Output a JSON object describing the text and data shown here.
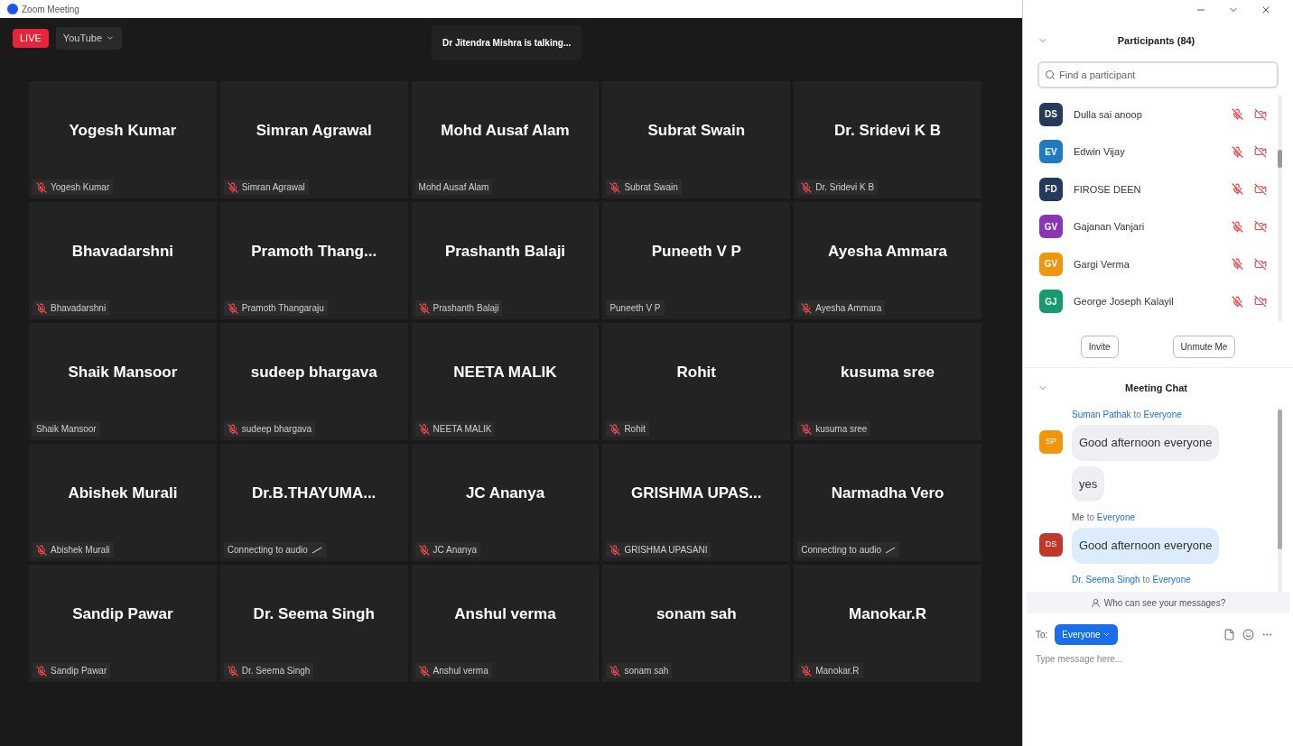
{
  "window": {
    "title": "Zoom Meeting"
  },
  "live": {
    "badge": "LIVE",
    "destination": "YouTube"
  },
  "speaker_banner": "Dr Jitendra Mishra is talking...",
  "tiles": [
    {
      "name": "Yogesh Kumar",
      "label": "Yogesh Kumar",
      "kind": "muted"
    },
    {
      "name": "Simran Agrawal",
      "label": "Simran Agrawal",
      "kind": "muted"
    },
    {
      "name": "Mohd Ausaf Alam",
      "label": "Mohd Ausaf Alam",
      "kind": "plain"
    },
    {
      "name": "Subrat Swain",
      "label": "Subrat Swain",
      "kind": "muted"
    },
    {
      "name": "Dr. Sridevi K B",
      "label": "Dr. Sridevi K B",
      "kind": "muted"
    },
    {
      "name": "Bhavadarshni",
      "label": "Bhavadarshni",
      "kind": "muted"
    },
    {
      "name": "Pramoth  Thang...",
      "label": "Pramoth Thangaraju",
      "kind": "muted"
    },
    {
      "name": "Prashanth Balaji",
      "label": "Prashanth Balaji",
      "kind": "muted"
    },
    {
      "name": "Puneeth V P",
      "label": "Puneeth V P",
      "kind": "plain"
    },
    {
      "name": "Ayesha Ammara",
      "label": "Ayesha Ammara",
      "kind": "muted"
    },
    {
      "name": "Shaik Mansoor",
      "label": "Shaik Mansoor",
      "kind": "plain"
    },
    {
      "name": "sudeep bhargava",
      "label": "sudeep bhargava",
      "kind": "muted"
    },
    {
      "name": "NEETA MALIK",
      "label": "NEETA MALIK",
      "kind": "muted"
    },
    {
      "name": "Rohit",
      "label": "Rohit",
      "kind": "muted"
    },
    {
      "name": "kusuma sree",
      "label": "kusuma sree",
      "kind": "muted"
    },
    {
      "name": "Abishek Murali",
      "label": "Abishek Murali",
      "kind": "muted"
    },
    {
      "name": "Dr.B.THAYUMA...",
      "label": "Connecting to audio",
      "kind": "connecting"
    },
    {
      "name": "JC Ananya",
      "label": "JC Ananya",
      "kind": "muted"
    },
    {
      "name": "GRISHMA  UPAS...",
      "label": "GRISHMA UPASANI",
      "kind": "muted"
    },
    {
      "name": "Narmadha Vero",
      "label": "Connecting to audio",
      "kind": "connecting"
    },
    {
      "name": "Sandip Pawar",
      "label": "Sandip Pawar",
      "kind": "muted"
    },
    {
      "name": "Dr. Seema Singh",
      "label": "Dr. Seema Singh",
      "kind": "muted"
    },
    {
      "name": "Anshul verma",
      "label": "Anshul verma",
      "kind": "muted"
    },
    {
      "name": "sonam sah",
      "label": "sonam sah",
      "kind": "muted"
    },
    {
      "name": "Manokar.R",
      "label": "Manokar.R",
      "kind": "muted"
    }
  ],
  "participants": {
    "title": "Participants (84)",
    "search": {
      "placeholder": "Find a participant"
    },
    "items": [
      {
        "initials": "DS",
        "name": "Dulla sai anoop",
        "color": "#243a5a"
      },
      {
        "initials": "EV",
        "name": "Edwin Vijay",
        "color": "#1f7ac4"
      },
      {
        "initials": "FD",
        "name": "FIROSE DEEN",
        "color": "#243a5a"
      },
      {
        "initials": "GV",
        "name": "Gajanan Vanjari",
        "color": "#8a34b8"
      },
      {
        "initials": "GV",
        "name": "Gargi Verma",
        "color": "#f0960c"
      },
      {
        "initials": "GJ",
        "name": "George Joseph Kalayil",
        "color": "#169a6e"
      }
    ],
    "buttons": [
      "Invite",
      "Unmute Me"
    ]
  },
  "chat": {
    "title": "Meeting Chat",
    "messages": [
      {
        "kind": "other",
        "sender": "Suman Pathak",
        "to_word": "to",
        "recipient": "Everyone",
        "initials": "SP",
        "color": "#f0960c",
        "bubbles": [
          "Good afternoon everyone",
          "yes"
        ]
      },
      {
        "kind": "self",
        "sender": "Me",
        "to_word": "to",
        "recipient": "Everyone",
        "initials": "DS",
        "color": "#c0392b",
        "bubbles": [
          "Good afternoon everyone"
        ]
      },
      {
        "kind": "other",
        "sender": "Dr. Seema Singh",
        "to_word": "to",
        "recipient": "Everyone"
      }
    ],
    "privacy_hint": "Who can see your messages?",
    "to_label": "To:",
    "recipient_button": "Everyone",
    "input": {
      "placeholder": "Type message here..."
    }
  }
}
